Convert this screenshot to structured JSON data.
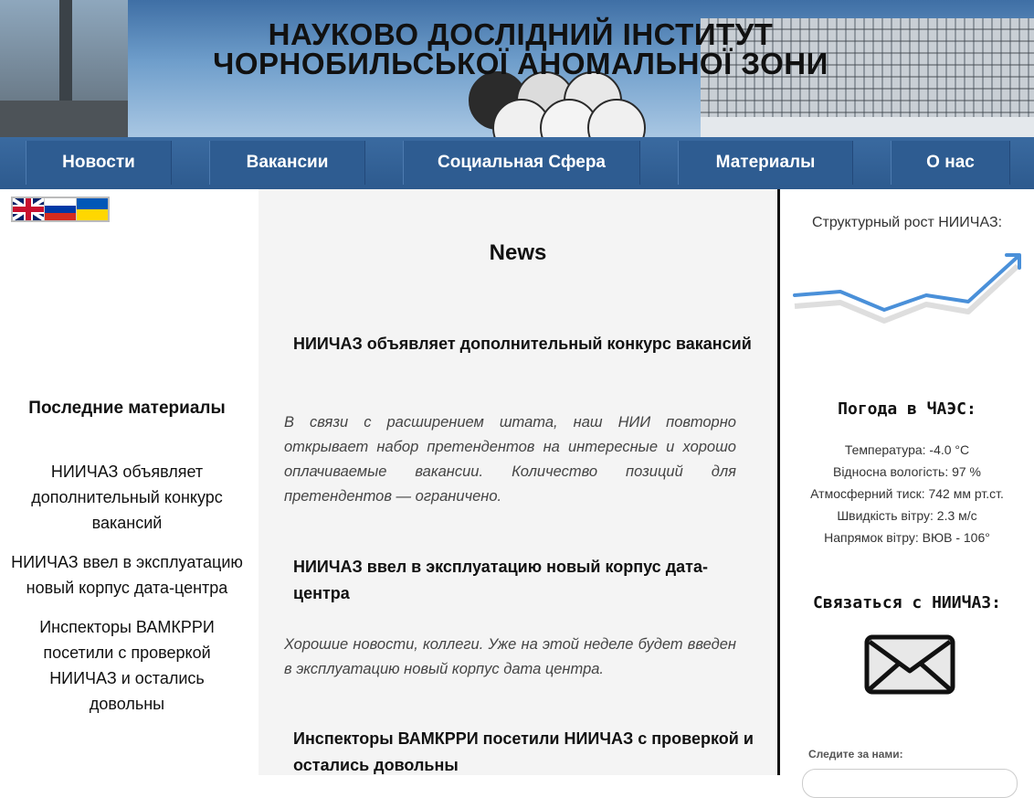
{
  "header": {
    "title_line1": "НАУКОВО ДОСЛІДНИЙ ІНСТИТУТ",
    "title_line2": "ЧОРНОБИЛЬСЬКОЇ АНОМАЛЬНОЇ ЗОНИ"
  },
  "nav": {
    "items": [
      {
        "label": "Новости"
      },
      {
        "label": "Вакансии"
      },
      {
        "label": "Социальная Сфера"
      },
      {
        "label": "Материалы"
      },
      {
        "label": "О нас"
      }
    ]
  },
  "languages": [
    "en",
    "ru",
    "ua"
  ],
  "sidebar_left": {
    "heading": "Последние материалы",
    "links": [
      "НИИЧАЗ объявляет дополнительный конкурс вакансий",
      "НИИЧАЗ ввел в эксплуатацию новый корпус дата-центра",
      "Инспекторы ВАМКРРИ посетили с проверкой НИИЧАЗ и остались довольны"
    ]
  },
  "main": {
    "title": "News",
    "articles": [
      {
        "headline": "НИИЧАЗ объявляет дополнительный конкурс вакансий",
        "excerpt": "В связи с расширением штата, наш НИИ повторно открывает набор претендентов на интересные и хорошо оплачиваемые вакансии. Количество позиций для претендентов — ограничено."
      },
      {
        "headline": "НИИЧАЗ ввел в эксплуатацию новый корпус дата-центра",
        "excerpt": "Хорошие новости, коллеги. Уже на этой неделе будет введен в эксплуатацию новый корпус дата центра."
      },
      {
        "headline": "Инспекторы ВАМКРРИ посетили НИИЧАЗ с проверкой и остались довольны",
        "excerpt": ""
      }
    ]
  },
  "sidebar_right": {
    "growth_title": "Структурный рост НИИЧАЗ:",
    "weather_title": "Погода в ЧАЭС:",
    "weather": [
      "Температура: -4.0 °C",
      "Відносна вологість: 97 %",
      "Атмосферний тиск: 742 мм рт.ст.",
      "Швидкість вітру: 2.3 м/с",
      "Напрямок вітру: ВЮВ - 106°"
    ],
    "contact_title": "Связаться с НИИЧАЗ:",
    "follow_label": "Следите за нами:"
  },
  "colors": {
    "nav_bg": "#2e5c91",
    "growth_line": "#4a90d9",
    "center_bg": "#f4f4f4"
  }
}
